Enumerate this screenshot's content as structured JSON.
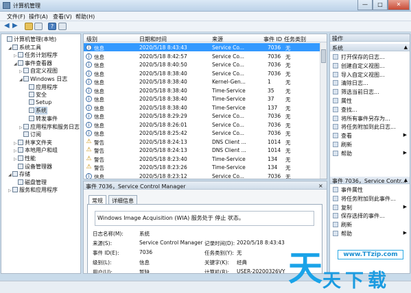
{
  "window": {
    "title": "计算机管理",
    "min": "—",
    "max": "□",
    "close": "✕"
  },
  "menu": [
    "文件(F)",
    "操作(A)",
    "查看(V)",
    "帮助(H)"
  ],
  "tree": [
    {
      "label": "计算机管理(本地)",
      "indent": 0,
      "exp": "",
      "icon": "computer-icon"
    },
    {
      "label": "系统工具",
      "indent": 1,
      "exp": "◢",
      "icon": "tools-icon"
    },
    {
      "label": "任务计划程序",
      "indent": 2,
      "exp": "▷",
      "icon": "clock-icon"
    },
    {
      "label": "事件查看器",
      "indent": 2,
      "exp": "◢",
      "icon": "event-viewer-icon"
    },
    {
      "label": "自定义视图",
      "indent": 3,
      "exp": "▷",
      "icon": "folder-icon"
    },
    {
      "label": "Windows 日志",
      "indent": 3,
      "exp": "◢",
      "icon": "folder-icon"
    },
    {
      "label": "应用程序",
      "indent": 4,
      "exp": "",
      "icon": "log-icon"
    },
    {
      "label": "安全",
      "indent": 4,
      "exp": "",
      "icon": "log-icon"
    },
    {
      "label": "Setup",
      "indent": 4,
      "exp": "",
      "icon": "log-icon"
    },
    {
      "label": "系统",
      "indent": 4,
      "exp": "",
      "icon": "log-icon"
    },
    {
      "label": "转发事件",
      "indent": 4,
      "exp": "",
      "icon": "log-icon"
    },
    {
      "label": "应用程序和服务日志",
      "indent": 3,
      "exp": "▷",
      "icon": "folder-icon"
    },
    {
      "label": "订阅",
      "indent": 3,
      "exp": "",
      "icon": "subscription-icon"
    },
    {
      "label": "共享文件夹",
      "indent": 2,
      "exp": "▷",
      "icon": "shared-folder-icon"
    },
    {
      "label": "本地用户和组",
      "indent": 2,
      "exp": "▷",
      "icon": "users-icon"
    },
    {
      "label": "性能",
      "indent": 2,
      "exp": "▷",
      "icon": "performance-icon"
    },
    {
      "label": "设备管理器",
      "indent": 2,
      "exp": "",
      "icon": "device-manager-icon"
    },
    {
      "label": "存储",
      "indent": 1,
      "exp": "◢",
      "icon": "storage-icon"
    },
    {
      "label": "磁盘管理",
      "indent": 2,
      "exp": "",
      "icon": "disk-icon"
    },
    {
      "label": "服务和应用程序",
      "indent": 1,
      "exp": "▷",
      "icon": "services-icon"
    }
  ],
  "columns": [
    "级别",
    "日期和时间",
    "来源",
    "事件 ID",
    "任务类别"
  ],
  "events": [
    {
      "level": "信息",
      "type": "info",
      "datetime": "2020/5/18 8:43:43",
      "source": "Service Co...",
      "id": "7036",
      "task": "无",
      "selected": true
    },
    {
      "level": "信息",
      "type": "info",
      "datetime": "2020/5/18 8:42:57",
      "source": "Service Co...",
      "id": "7036",
      "task": "无"
    },
    {
      "level": "信息",
      "type": "info",
      "datetime": "2020/5/18 8:40:50",
      "source": "Service Co...",
      "id": "7036",
      "task": "无"
    },
    {
      "level": "信息",
      "type": "info",
      "datetime": "2020/5/18 8:38:40",
      "source": "Service Co...",
      "id": "7036",
      "task": "无"
    },
    {
      "level": "信息",
      "type": "info",
      "datetime": "2020/5/18 8:38:40",
      "source": "Kernel-Gen...",
      "id": "1",
      "task": "无"
    },
    {
      "level": "信息",
      "type": "info",
      "datetime": "2020/5/18 8:38:40",
      "source": "Time-Service",
      "id": "35",
      "task": "无"
    },
    {
      "level": "信息",
      "type": "info",
      "datetime": "2020/5/18 8:38:40",
      "source": "Time-Service",
      "id": "37",
      "task": "无"
    },
    {
      "level": "信息",
      "type": "info",
      "datetime": "2020/5/18 8:38:40",
      "source": "Time-Service",
      "id": "137",
      "task": "无"
    },
    {
      "level": "信息",
      "type": "info",
      "datetime": "2020/5/18 8:29:29",
      "source": "Service Co...",
      "id": "7036",
      "task": "无"
    },
    {
      "level": "信息",
      "type": "info",
      "datetime": "2020/5/18 8:26:01",
      "source": "Service Co...",
      "id": "7036",
      "task": "无"
    },
    {
      "level": "信息",
      "type": "info",
      "datetime": "2020/5/18 8:25:42",
      "source": "Service Co...",
      "id": "7036",
      "task": "无"
    },
    {
      "level": "警告",
      "type": "warn",
      "datetime": "2020/5/18 8:24:13",
      "source": "DNS Client ...",
      "id": "1014",
      "task": "无"
    },
    {
      "level": "警告",
      "type": "warn",
      "datetime": "2020/5/18 8:24:13",
      "source": "DNS Client ...",
      "id": "1014",
      "task": "无"
    },
    {
      "level": "警告",
      "type": "warn",
      "datetime": "2020/5/18 8:23:40",
      "source": "Time-Service",
      "id": "134",
      "task": "无"
    },
    {
      "level": "警告",
      "type": "warn",
      "datetime": "2020/5/18 8:23:26",
      "source": "Time-Service",
      "id": "134",
      "task": "无"
    },
    {
      "level": "信息",
      "type": "info",
      "datetime": "2020/5/18 8:23:12",
      "source": "Service Co...",
      "id": "7036",
      "task": "无"
    }
  ],
  "detail": {
    "header": "事件 7036，Service Control Manager",
    "close": "×",
    "tabs": [
      "常规",
      "详细信息"
    ],
    "message": "Windows Image Acquisition (WIA) 服务处于 停止 状态。",
    "fields": [
      {
        "label": "日志名称(M):",
        "value": "系统"
      },
      {
        "label": "来源(S):",
        "value": "Service Control Manager"
      },
      {
        "label": "事件 ID(E):",
        "value": "7036"
      },
      {
        "label": "级别(L):",
        "value": "信息"
      },
      {
        "label": "用户(U):",
        "value": "暂缺"
      },
      {
        "label": "记录时间(D):",
        "value": "2020/5/18 8:43:43"
      },
      {
        "label": "任务类别(Y):",
        "value": "无"
      },
      {
        "label": "关键字(K):",
        "value": "经典"
      },
      {
        "label": "计算机(R):",
        "value": "USER-20200326VY"
      }
    ]
  },
  "actions": {
    "header": "操作",
    "section1": "系统",
    "items1": [
      "打开保存的日志...",
      "创建自定义视图...",
      "导入自定义视图...",
      "清除日志...",
      "筛选当前日志...",
      "属性",
      "查找...",
      "将所有事件另存为...",
      "将任务附加到此日志...",
      "查看",
      "刷新",
      "帮助"
    ],
    "section2": "事件 7036，Service Contr...",
    "items2": [
      "事件属性",
      "将任务附加到此事件...",
      "复制",
      "保存选择的事件...",
      "刷新",
      "帮助"
    ]
  },
  "watermark": {
    "big": "天",
    "url": "www.TTzip.com",
    "cn": "天下载"
  }
}
